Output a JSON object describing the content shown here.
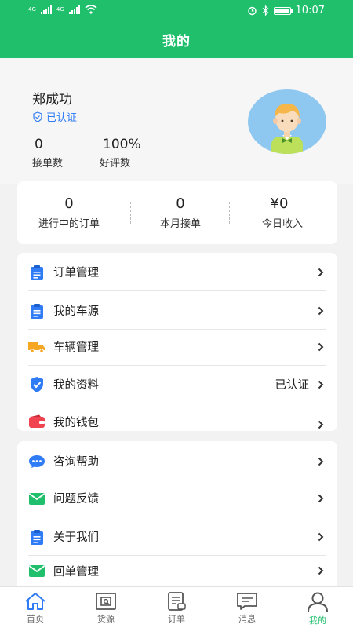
{
  "status_bar": {
    "network_left": "4G",
    "network_right": "4G",
    "time": "10:07"
  },
  "header": {
    "title": "我的"
  },
  "profile": {
    "name": "郑成功",
    "verified_label": "已认证",
    "stats": [
      {
        "value": "0",
        "label": "接单数"
      },
      {
        "value": "100%",
        "label": "好评数"
      }
    ]
  },
  "summary": {
    "items": [
      {
        "value": "0",
        "label": "进行中的订单"
      },
      {
        "value": "0",
        "label": "本月接单"
      },
      {
        "value": "¥0",
        "label": "今日收入"
      }
    ]
  },
  "menu1": {
    "items": [
      {
        "label": "订单管理",
        "icon": "clipboard-icon",
        "value": ""
      },
      {
        "label": "我的车源",
        "icon": "clipboard-icon",
        "value": ""
      },
      {
        "label": "车辆管理",
        "icon": "truck-icon",
        "value": ""
      },
      {
        "label": "我的资料",
        "icon": "shield-check-icon",
        "value": "已认证"
      },
      {
        "label": "我的钱包",
        "icon": "wallet-icon",
        "value": ""
      }
    ]
  },
  "menu2": {
    "items": [
      {
        "label": "咨询帮助",
        "icon": "chat-bubble-icon"
      },
      {
        "label": "问题反馈",
        "icon": "envelope-icon"
      },
      {
        "label": "关于我们",
        "icon": "clipboard-icon"
      },
      {
        "label": "回单管理",
        "icon": "envelope-icon"
      }
    ]
  },
  "tabbar": {
    "tabs": [
      {
        "label": "首页",
        "icon": "home-icon"
      },
      {
        "label": "货源",
        "icon": "cargo-icon"
      },
      {
        "label": "订单",
        "icon": "order-icon"
      },
      {
        "label": "消息",
        "icon": "message-icon"
      },
      {
        "label": "我的",
        "icon": "user-icon",
        "active": true
      }
    ]
  },
  "colors": {
    "brand": "#1fbf6c",
    "verified_blue": "#2f7cf6",
    "background": "#f2f2f2"
  }
}
